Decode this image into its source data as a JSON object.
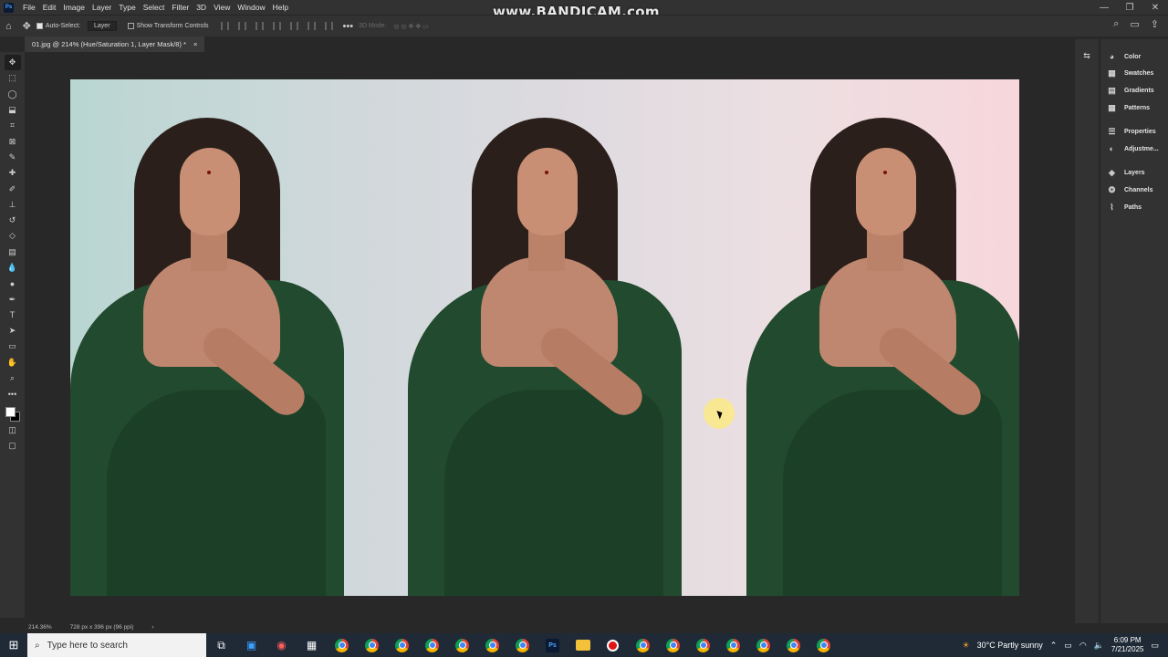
{
  "app": {
    "watermark": "www.BANDICAM.com",
    "menu": [
      "File",
      "Edit",
      "Image",
      "Layer",
      "Type",
      "Select",
      "Filter",
      "3D",
      "View",
      "Window",
      "Help"
    ]
  },
  "options_bar": {
    "auto_select_label": "Auto-Select:",
    "auto_select_target": "Layer",
    "show_transform_label": "Show Transform Controls",
    "mode_3d_label": "3D Mode:"
  },
  "document": {
    "tab_title": "01.jpg @ 214% (Hue/Saturation 1, Layer Mask/8) *",
    "close_glyph": "×"
  },
  "status": {
    "zoom": "214.36%",
    "doc_size": "728 px x 396 px (96 ppi)"
  },
  "panels": {
    "items": [
      {
        "label": "Color",
        "icon": "color-wheel-icon"
      },
      {
        "label": "Swatches",
        "icon": "grid-icon"
      },
      {
        "label": "Gradients",
        "icon": "gradient-icon"
      },
      {
        "label": "Patterns",
        "icon": "pattern-icon"
      },
      {
        "label": "Properties",
        "icon": "properties-icon"
      },
      {
        "label": "Adjustme...",
        "icon": "adjustments-icon"
      },
      {
        "label": "Layers",
        "icon": "layers-icon"
      },
      {
        "label": "Channels",
        "icon": "channels-icon"
      },
      {
        "label": "Paths",
        "icon": "paths-icon"
      }
    ]
  },
  "taskbar": {
    "search_placeholder": "Type here to search",
    "weather": "30°C  Partly sunny",
    "time": "6:09 PM",
    "date": "7/21/2025"
  }
}
